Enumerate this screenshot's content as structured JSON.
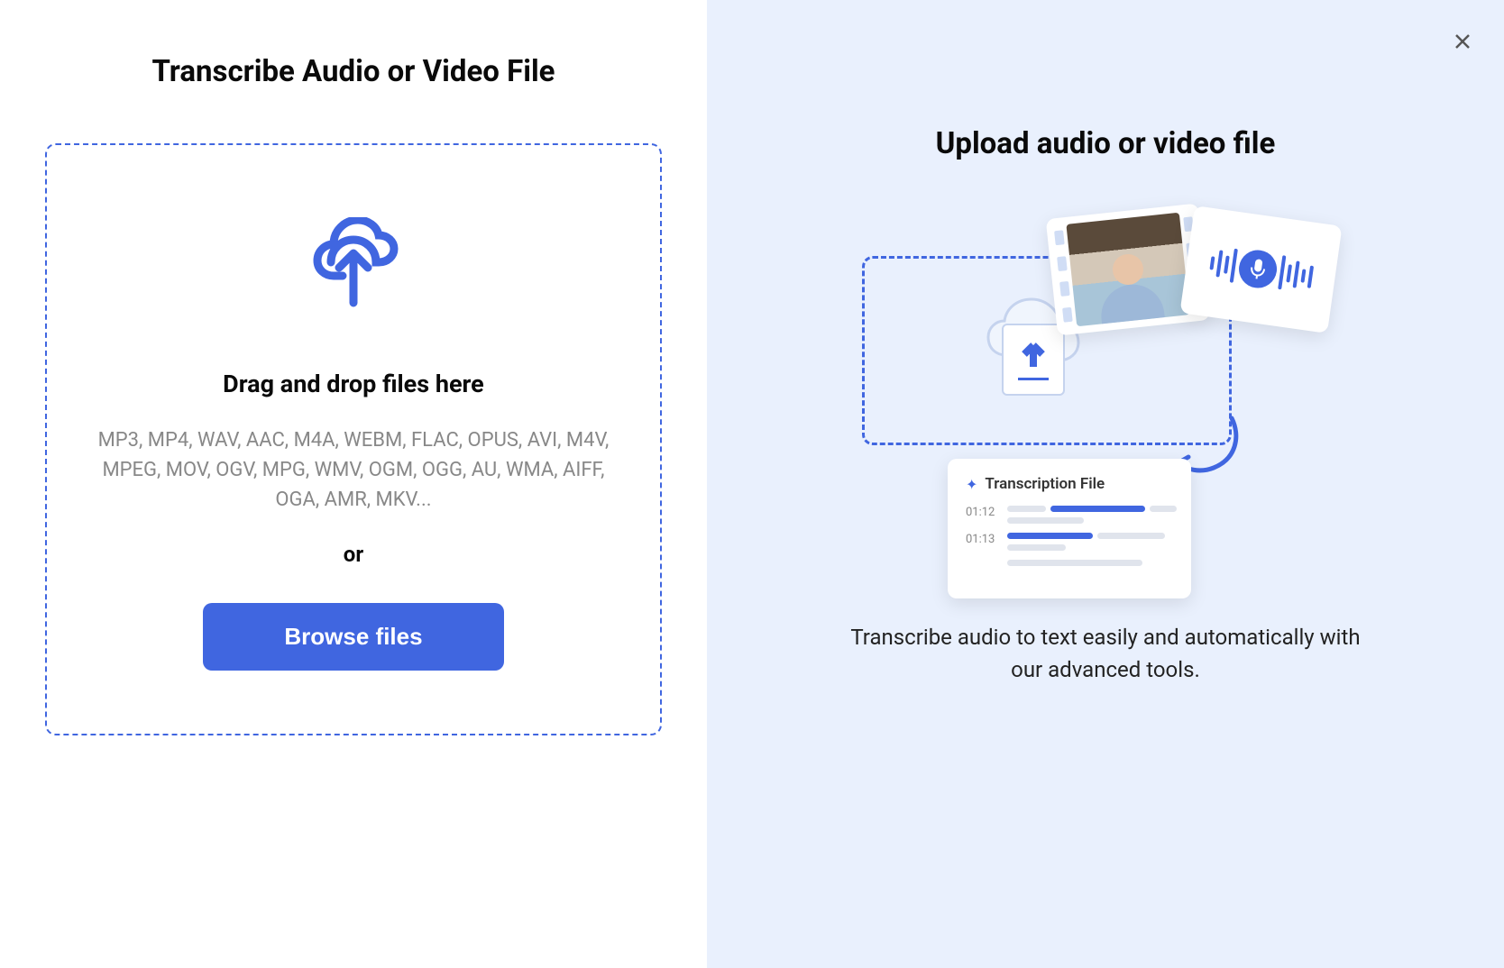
{
  "left": {
    "title": "Transcribe Audio or Video File",
    "dropzone": {
      "heading": "Drag and drop files here",
      "formats": "MP3, MP4, WAV, AAC, M4A, WEBM, FLAC, OPUS, AVI, M4V, MPEG, MOV, OGV, MPG, WMV, OGM, OGG, AU, WMA, AIFF, OGA, AMR, MKV...",
      "or": "or",
      "browse_label": "Browse files"
    }
  },
  "right": {
    "title": "Upload audio or video file",
    "illustration": {
      "transcript_card_title": "Transcription File",
      "timestamp1": "01:12",
      "timestamp2": "01:13"
    },
    "description": "Transcribe audio to text easily and automatically with our advanced tools."
  }
}
